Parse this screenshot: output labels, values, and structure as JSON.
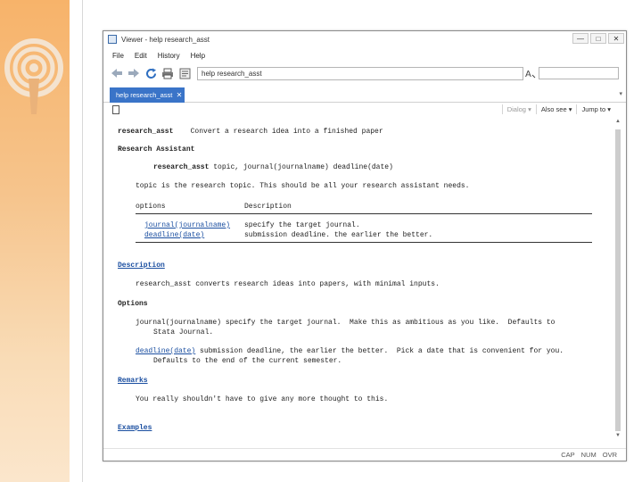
{
  "window": {
    "title": "Viewer - help research_asst",
    "controls": [
      "—",
      "□",
      "✕"
    ]
  },
  "menu": [
    "File",
    "Edit",
    "History",
    "Help"
  ],
  "toolbar": {
    "address_value": "help research_asst",
    "search_placeholder": "",
    "icons": [
      "back-arrow-icon",
      "forward-arrow-icon",
      "refresh-icon",
      "print-icon",
      "find-icon"
    ]
  },
  "tab": {
    "label": "help research_asst",
    "close": "✕"
  },
  "viewer_bar": {
    "dialog": "Dialog ▾",
    "also_see": "Also see ▾",
    "jump_to": "Jump to ▾"
  },
  "help": {
    "title_cmd": "research_asst",
    "title_desc": "Convert a research idea into a finished paper",
    "section_research": "Research Assistant",
    "syntax_cmd": "research_asst",
    "syntax_rest": "topic, journal(journalname) deadline(date)",
    "topic_word": "topic",
    "topic_text": "is the research topic. This should be all your research assistant needs.",
    "options_header": "options",
    "description_header": "Description",
    "opt1_name": "journal(journalname)",
    "opt1_desc": "specify the target journal.",
    "opt2_name": "deadline(date)",
    "opt2_desc": "submission deadline. the earlier the better.",
    "section_description": "Description",
    "description_text": "research_asst converts research ideas into papers, with minimal inputs.",
    "section_options": "Options",
    "opt_journal_line1": "journal(journalname) specify the target journal.  Make this as ambitious as you like.  Defaults to",
    "opt_journal_line2": "Stata Journal.",
    "opt_deadline_name": "deadline(date)",
    "opt_deadline_line1": " submission deadline, the earlier the better.  Pick a date that is convenient for you.",
    "opt_deadline_line2": "Defaults to the end of the current semester.",
    "section_remarks": "Remarks",
    "remarks_text": "You really shouldn't have to give any more thought to this.",
    "section_examples": "Examples"
  },
  "status": [
    "CAP",
    "NUM",
    "OVR"
  ],
  "colors": {
    "tab_active": "#3a74c8",
    "slide_accent": "#f7b36a",
    "link": "#1a4ea0"
  }
}
